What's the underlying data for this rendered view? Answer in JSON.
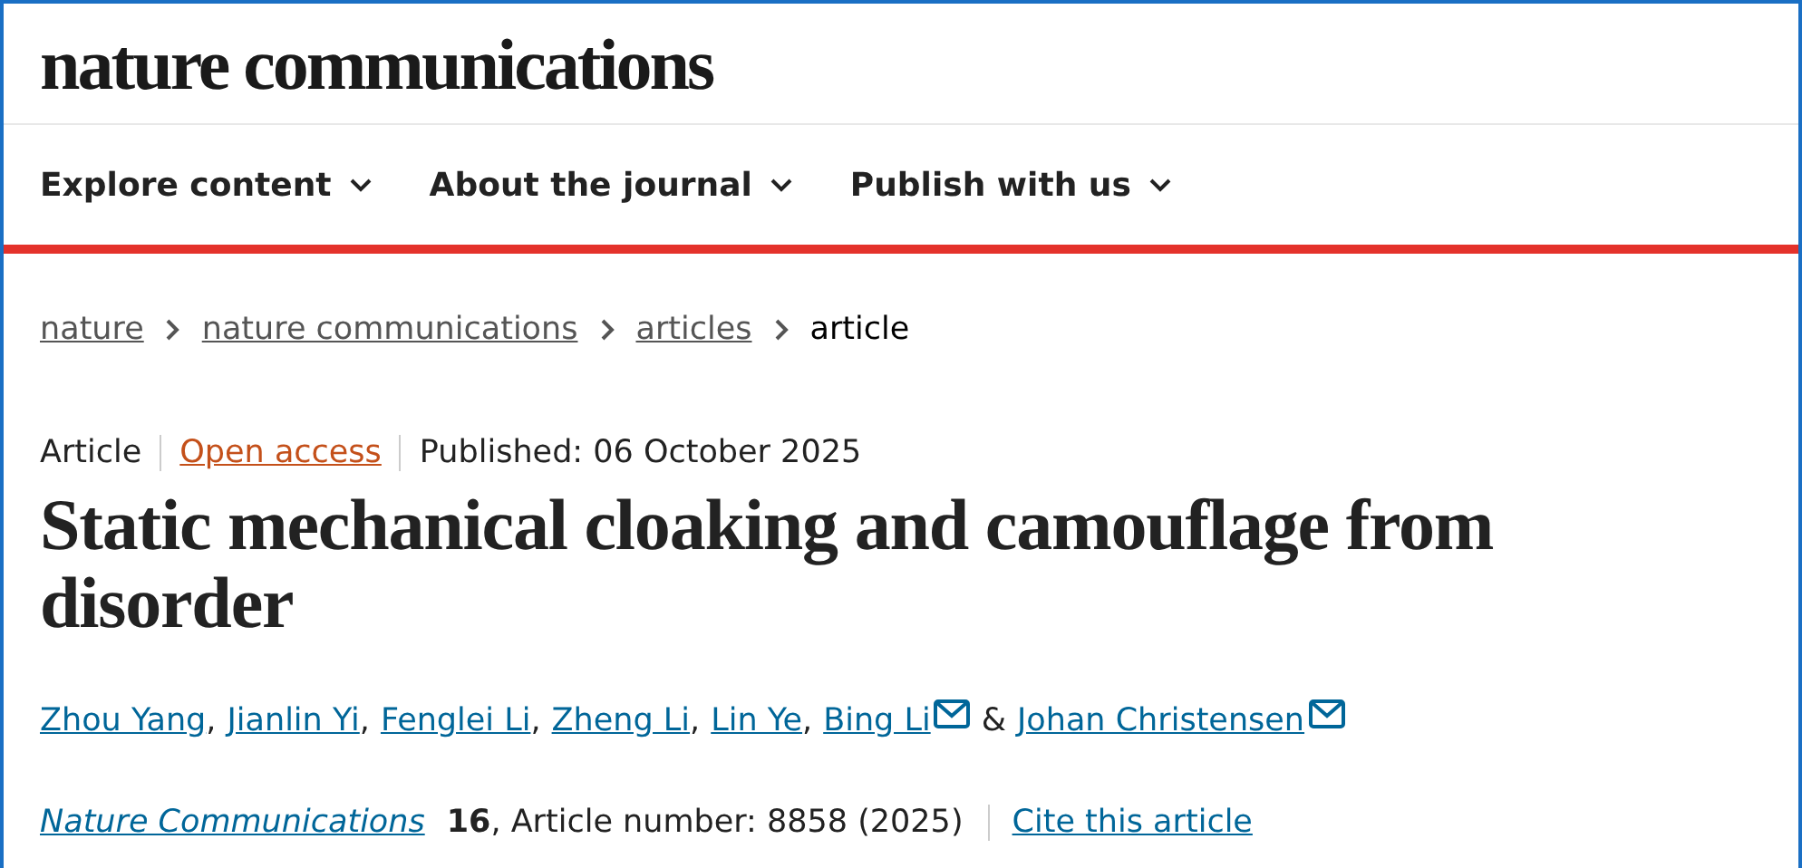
{
  "logo": "nature communications",
  "nav": [
    {
      "label": "Explore content"
    },
    {
      "label": "About the journal"
    },
    {
      "label": "Publish with us"
    }
  ],
  "breadcrumbs": [
    {
      "label": "nature",
      "current": false
    },
    {
      "label": "nature communications",
      "current": false
    },
    {
      "label": "articles",
      "current": false
    },
    {
      "label": "article",
      "current": true
    }
  ],
  "meta": {
    "type": "Article",
    "access": "Open access",
    "published": "Published: 06 October 2025"
  },
  "title": "Static mechanical cloaking and camouflage from disorder",
  "authors": [
    {
      "name": "Zhou Yang",
      "email": false,
      "joiner": ","
    },
    {
      "name": "Jianlin Yi",
      "email": false,
      "joiner": ","
    },
    {
      "name": "Fenglei Li",
      "email": false,
      "joiner": ","
    },
    {
      "name": "Zheng Li",
      "email": false,
      "joiner": ","
    },
    {
      "name": "Lin Ye",
      "email": false,
      "joiner": ","
    },
    {
      "name": "Bing Li",
      "email": true,
      "joiner": "&"
    },
    {
      "name": "Johan Christensen",
      "email": true
    }
  ],
  "citation": {
    "journal": "Nature Communications",
    "details": "**16**, Article number: 8858 (2025)",
    "cite_link": "Cite this article"
  }
}
